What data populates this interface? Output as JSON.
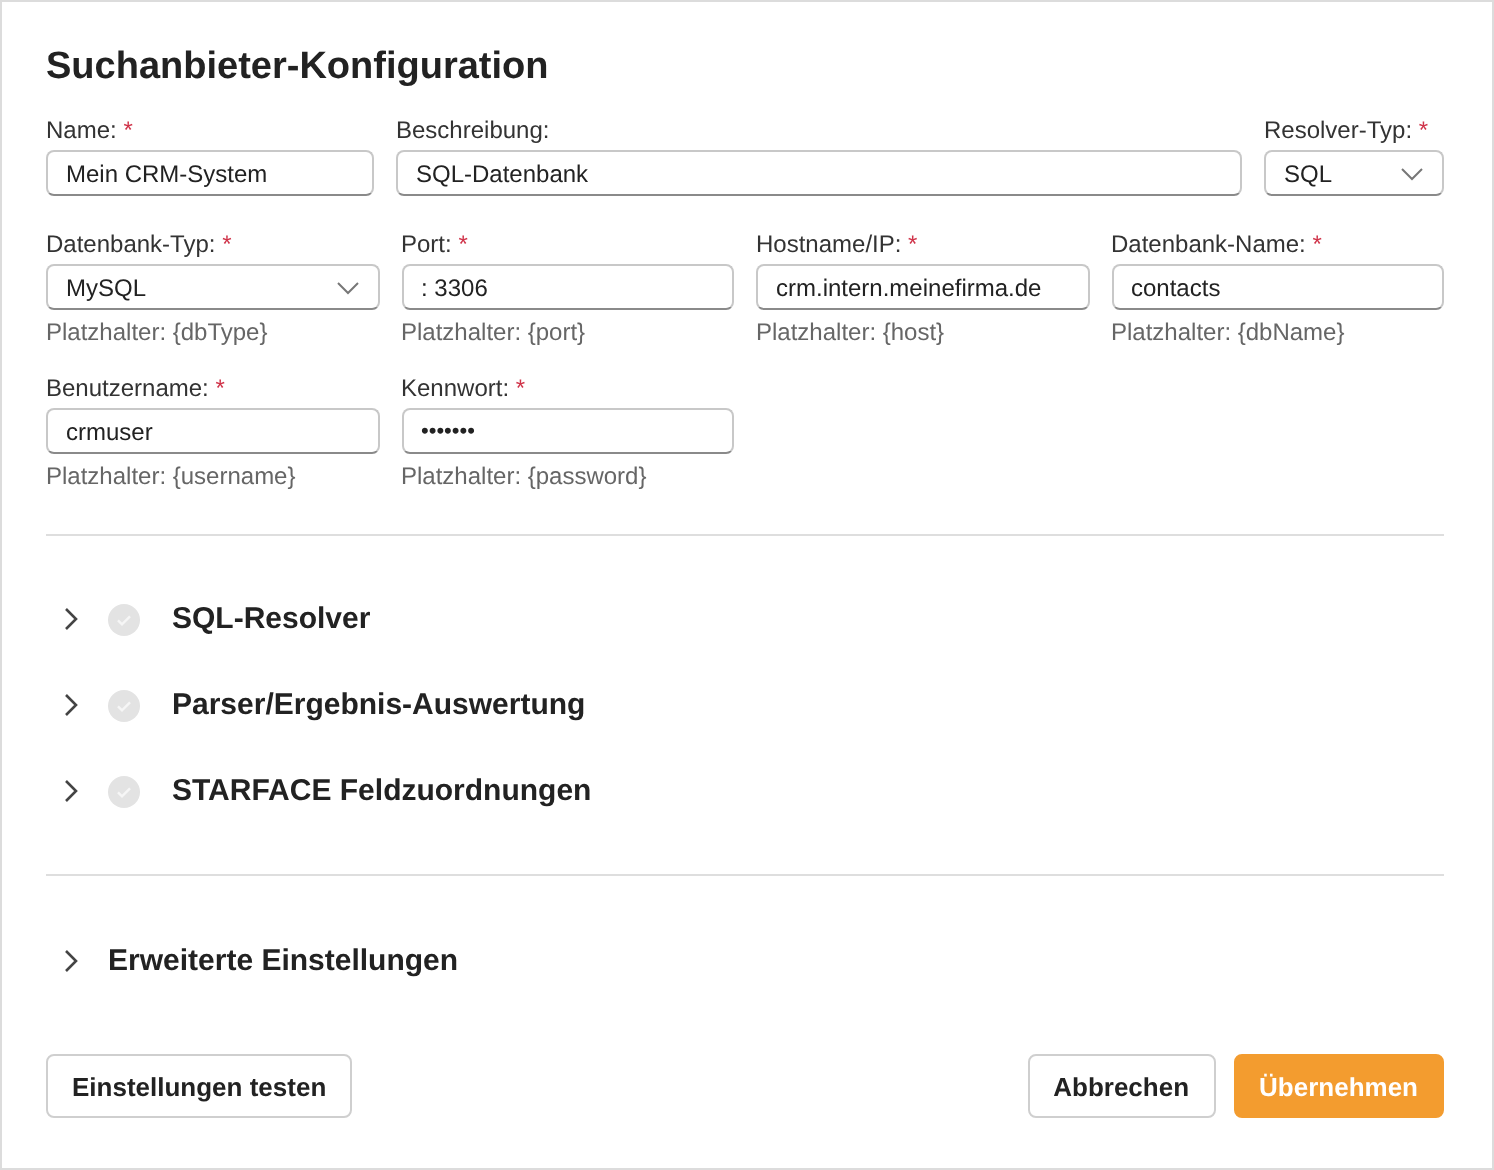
{
  "dialog": {
    "title": "Suchanbieter-Konfiguration"
  },
  "field_rows": [
    [
      {
        "kind": "text",
        "label": "Name:",
        "required_mark": "*",
        "value": "Mein CRM-System"
      },
      {
        "kind": "text",
        "label": "Beschreibung:",
        "value": "SQL-Datenbank"
      },
      {
        "kind": "select",
        "label": "Resolver-Typ:",
        "required_mark": "*",
        "value": "SQL"
      }
    ],
    [
      {
        "kind": "select",
        "label": "Datenbank-Typ:",
        "required_mark": "*",
        "value": "MySQL",
        "hint": "Platzhalter: {dbType}"
      },
      {
        "kind": "text",
        "label": "Port:",
        "required_mark": "*",
        "value": ": 3306",
        "hint": "Platzhalter: {port}"
      },
      {
        "kind": "text",
        "label": "Hostname/IP:",
        "required_mark": "*",
        "value": "crm.intern.meinefirma.de",
        "hint": "Platzhalter: {host}"
      },
      {
        "kind": "text",
        "label": "Datenbank-Name:",
        "required_mark": "*",
        "value": "contacts",
        "hint": "Platzhalter: {dbName}"
      }
    ],
    [
      {
        "kind": "text",
        "label": "Benutzername:",
        "required_mark": "*",
        "value": "crmuser",
        "hint": "Platzhalter: {username}"
      },
      {
        "kind": "password",
        "label": "Kennwort:",
        "required_mark": "*",
        "value": "•••••••",
        "hint": "Platzhalter: {password}"
      }
    ]
  ],
  "sections": [
    {
      "title": "SQL-Resolver",
      "expanded": false,
      "done": false
    },
    {
      "title": "Parser/Ergebnis-Auswertung",
      "expanded": false,
      "done": false
    },
    {
      "title": "STARFACE Feldzuordnungen",
      "expanded": false,
      "done": false
    }
  ],
  "advanced": {
    "title": "Erweiterte Einstellungen",
    "expanded": false
  },
  "footer": {
    "left_buttons": [
      {
        "label": "Einstellungen testen",
        "kind": "secondary"
      }
    ],
    "right_buttons": [
      {
        "label": "Abbrechen",
        "kind": "secondary"
      },
      {
        "label": "Übernehmen",
        "kind": "primary"
      }
    ]
  }
}
